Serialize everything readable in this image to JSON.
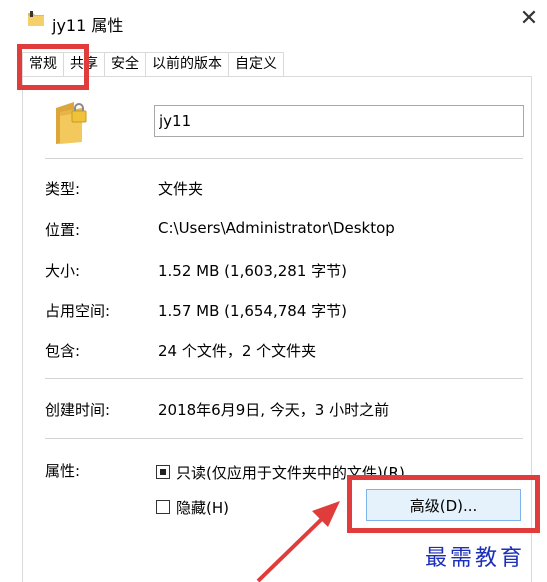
{
  "window": {
    "title": "jy11 属性",
    "close_glyph": "✕"
  },
  "tabs": [
    {
      "label": "常规",
      "active": true
    },
    {
      "label": "共享",
      "active": false
    },
    {
      "label": "安全",
      "active": false
    },
    {
      "label": "以前的版本",
      "active": false
    },
    {
      "label": "自定义",
      "active": false
    }
  ],
  "general": {
    "folder_icon": "locked-folder-icon",
    "name_value": "jy11",
    "rows": [
      {
        "label": "类型:",
        "value": "文件夹"
      },
      {
        "label": "位置:",
        "value": "C:\\Users\\Administrator\\Desktop"
      },
      {
        "label": "大小:",
        "value": "1.52 MB (1,603,281 字节)"
      },
      {
        "label": "占用空间:",
        "value": "1.57 MB (1,654,784 字节)"
      },
      {
        "label": "包含:",
        "value": "24 个文件，2 个文件夹"
      }
    ],
    "created": {
      "label": "创建时间:",
      "value": "2018年6月9日, 今天，3 小时之前"
    },
    "attributes": {
      "label": "属性:",
      "readonly_label": "只读(仅应用于文件夹中的文件)(R)",
      "readonly_state": "indeterminate",
      "hidden_label": "隐藏(H)",
      "hidden_checked": false,
      "advanced_button": "高级(D)..."
    }
  },
  "annotations": {
    "highlight_color": "#e03c3c",
    "arrow_color": "#e03c3c"
  },
  "watermark": {
    "text": "最需教育",
    "color": "#1c2fb8"
  }
}
